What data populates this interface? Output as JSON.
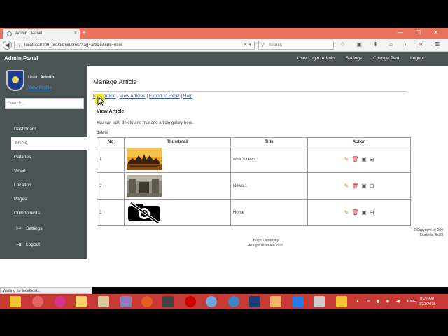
{
  "browser": {
    "tab_title": "Admin CPanel",
    "tab_close": "×",
    "new_tab": "+",
    "window_buttons": "— ☐ ✕",
    "url": "localhost/209_pro/admin/cms/?tag=article&sub=new",
    "search_placeholder": "Search",
    "status_text": "Waiting for localhost..."
  },
  "topbar": {
    "brand": "Admin Panel",
    "user_login": "User Login: Admin",
    "settings": "Settings",
    "change_pwd": "Change Pwd",
    "logout": "Logout"
  },
  "sidebar": {
    "user_label": "User:",
    "user_name": "Admin",
    "view_profile": "View Profile",
    "search_placeholder": "Search ...",
    "items": [
      {
        "label": "Dashboard"
      },
      {
        "label": "Article"
      },
      {
        "label": "Galaries"
      },
      {
        "label": "Video"
      },
      {
        "label": "Location"
      },
      {
        "label": "Pages"
      },
      {
        "label": "Components"
      },
      {
        "label": "Settings"
      },
      {
        "label": "Logout"
      }
    ]
  },
  "main": {
    "title": "Manage Article",
    "links": {
      "new_article": "New Article",
      "view_articles": "View Articles",
      "export": "Export to Excel",
      "help": "Help",
      "sep": " | "
    },
    "subtitle": "View Article",
    "description": "You can edit, delete and manage article galary here.",
    "delete_label": "delete",
    "table": {
      "headers": [
        "No",
        "Thumbnail",
        "Title",
        "Action"
      ],
      "rows": [
        {
          "no": "1",
          "title": "what's news",
          "thumb": "sunset-temple"
        },
        {
          "no": "2",
          "title": "News 1",
          "thumb": "ruins"
        },
        {
          "no": "3",
          "title": "Home",
          "thumb": "no-image"
        }
      ]
    },
    "copyright_1": "©Copyright by 209",
    "copyright_2": "Students, Build",
    "footer_1": "Bright University",
    "footer_2": "All right reserved 2015"
  },
  "taskbar": {
    "language": "ENG",
    "time": "8:22 AM",
    "date": "8/31/2015"
  },
  "colors": {
    "sidebar_bg": "#4a5454",
    "tab_bar": "#e8725c",
    "taskbar": "#c53a33",
    "link": "#3b5ba9"
  }
}
